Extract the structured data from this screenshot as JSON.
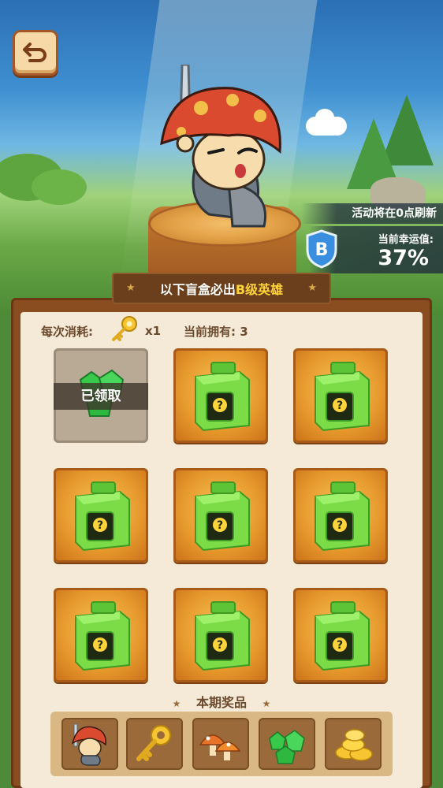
{
  "top": {
    "refresh_notice": "活动将在0点刷新",
    "luck_label": "当前幸运值:",
    "luck_value": "37%",
    "luck_grade": "B"
  },
  "banner": {
    "text_prefix": "以下盲盒必出",
    "text_highlight": "B级英雄"
  },
  "cost": {
    "label": "每次消耗:",
    "quantity": "x1",
    "owned": "当前拥有: 3"
  },
  "boxes": [
    {
      "state": "claimed",
      "label": "已领取",
      "icon": "emerald-gems-icon"
    },
    {
      "state": "closed",
      "icon": "mystery-box-icon"
    },
    {
      "state": "closed",
      "icon": "mystery-box-icon"
    },
    {
      "state": "closed",
      "icon": "mystery-box-icon"
    },
    {
      "state": "closed",
      "icon": "mystery-box-icon"
    },
    {
      "state": "closed",
      "icon": "mystery-box-icon"
    },
    {
      "state": "closed",
      "icon": "mystery-box-icon"
    },
    {
      "state": "closed",
      "icon": "mystery-box-icon"
    },
    {
      "state": "closed",
      "icon": "mystery-box-icon"
    }
  ],
  "prizes": {
    "title": "本期奖品",
    "items": [
      "hero-icon",
      "key-icon",
      "mushroom-icon",
      "emerald-gems-icon",
      "gold-coins-icon"
    ]
  },
  "colors": {
    "accent": "#ffd43a",
    "board": "#8a4d1f",
    "panel": "#f4ead7",
    "box_green": "#6fd13a"
  }
}
